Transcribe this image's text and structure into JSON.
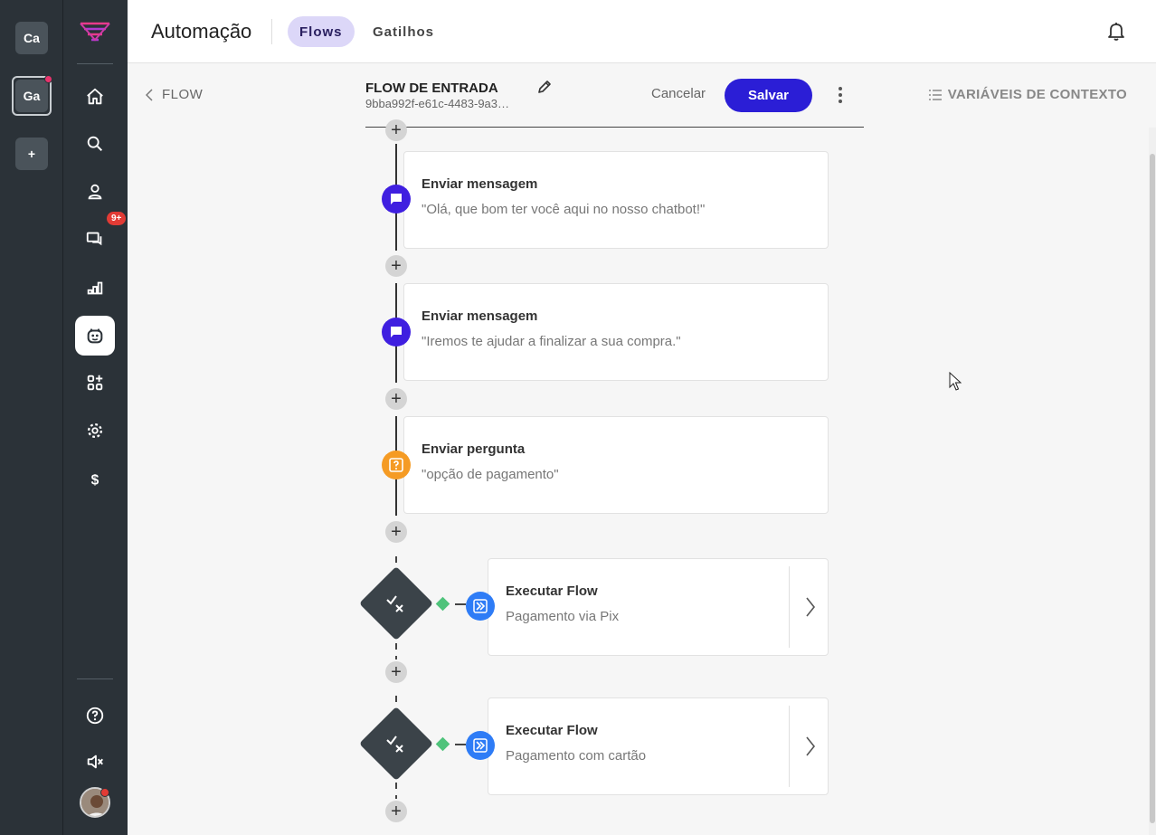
{
  "workspaces": [
    {
      "label": "Ca",
      "active": false,
      "dot": false
    },
    {
      "label": "Ga",
      "active": true,
      "dot": true
    },
    {
      "label": "+",
      "active": false,
      "dot": false
    }
  ],
  "nav": {
    "items": [
      "home-icon",
      "search-icon",
      "contacts-icon",
      "chat-icon",
      "reports-icon",
      "bot-icon",
      "apps-icon",
      "settings-icon",
      "billing-icon"
    ],
    "chat_badge": "9+",
    "selected": "bot-icon",
    "bottom_items": [
      "help-icon",
      "mute-icon",
      "avatar"
    ]
  },
  "header": {
    "title": "Automação",
    "tabs": [
      {
        "label": "Flows",
        "active": true
      },
      {
        "label": "Gatilhos",
        "active": false
      }
    ]
  },
  "toolbar": {
    "back_label": "FLOW",
    "flow_name": "FLOW DE ENTRADA",
    "flow_id": "9bba992f-e61c-4483-9a3…",
    "cancel_label": "Cancelar",
    "save_label": "Salvar",
    "context_vars_label": "VARIÁVEIS DE CONTEXTO"
  },
  "flow": {
    "steps": [
      {
        "type": "message",
        "title": "Enviar mensagem",
        "text": "\"Olá, que bom ter você aqui no nosso chatbot!\""
      },
      {
        "type": "message",
        "title": "Enviar mensagem",
        "text": "\"Iremos te ajudar a finalizar a sua compra.\""
      },
      {
        "type": "question",
        "title": "Enviar pergunta",
        "text": "\"opção de pagamento\""
      },
      {
        "type": "execute",
        "title": "Executar Flow",
        "text": "Pagamento via Pix"
      },
      {
        "type": "execute",
        "title": "Executar Flow",
        "text": "Pagamento com cartão"
      }
    ]
  },
  "colors": {
    "brand": "#2b1ed6",
    "message_node": "#3f1fe0",
    "question_node": "#f59b24",
    "execute_node": "#2e7cf6",
    "condition_dot": "#4fc37b",
    "sidebar": "#2b3238"
  }
}
